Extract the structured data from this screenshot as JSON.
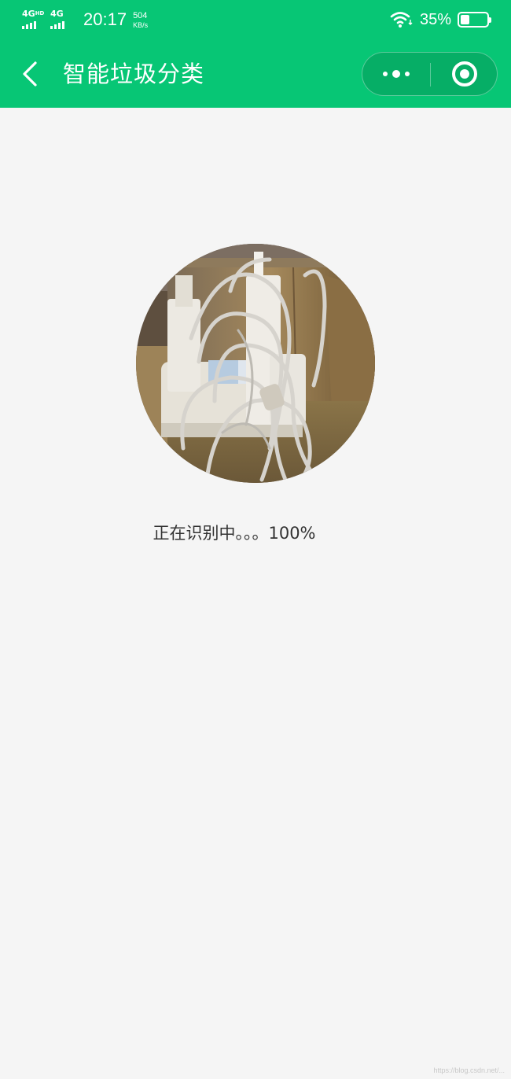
{
  "status_bar": {
    "network_1": "4G",
    "network_1_suffix": "HD",
    "network_2": "4G",
    "time": "20:17",
    "speed_value": "504",
    "speed_unit": "KB/s",
    "battery_percent": "35%",
    "battery_level": 0.35
  },
  "nav": {
    "title": "智能垃圾分类"
  },
  "main": {
    "status_text": "正在识别中。。。100%"
  },
  "watermark": "https://blog.csdn.net/...",
  "colors": {
    "header_bg": "#07c675",
    "page_bg": "#f5f5f5",
    "text": "#333333"
  },
  "icons": {
    "back": "back-chevron-icon",
    "more": "more-dots-icon",
    "close": "target-circle-icon",
    "wifi": "wifi-icon",
    "battery": "battery-icon"
  }
}
